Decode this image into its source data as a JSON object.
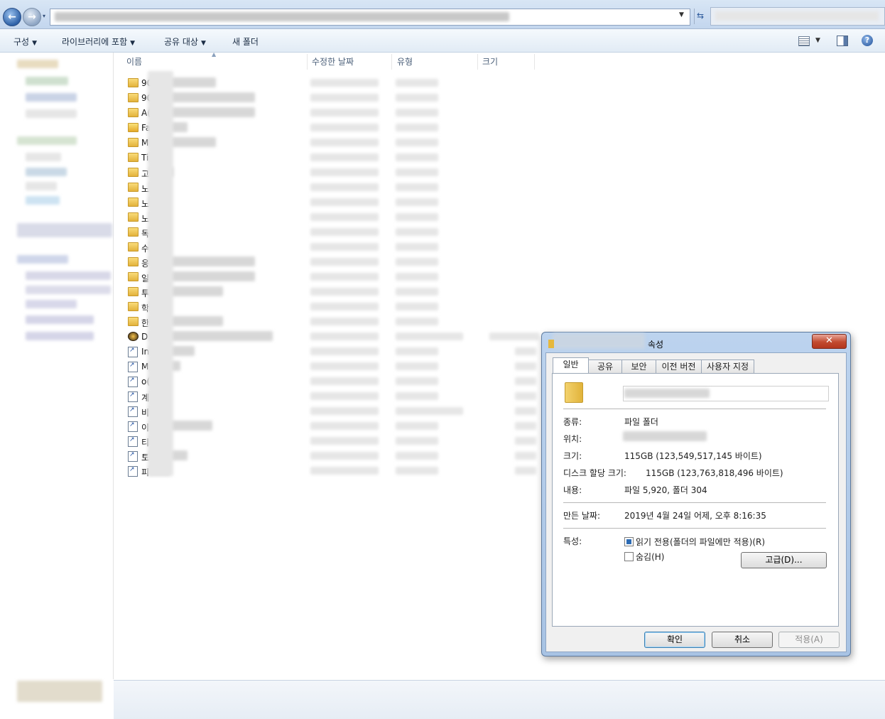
{
  "toolbar": {
    "organize": "구성",
    "include_in_library": "라이브러리에 포함",
    "share_with": "공유 대상",
    "new_folder": "새 폴더"
  },
  "columns": {
    "name": "이름",
    "date_modified": "수정한 날짜",
    "type": "유형",
    "size": "크기"
  },
  "files": [
    {
      "name": "90",
      "icon": "folder-icon"
    },
    {
      "name": "90",
      "icon": "folder-icon"
    },
    {
      "name": "A(",
      "icon": "folder-icon"
    },
    {
      "name": "Fa",
      "icon": "favorites-folder-icon"
    },
    {
      "name": "M",
      "icon": "folder-icon"
    },
    {
      "name": "Ti",
      "icon": "folder-icon"
    },
    {
      "name": "고",
      "icon": "folder-icon"
    },
    {
      "name": "노",
      "icon": "folder-icon"
    },
    {
      "name": "노",
      "icon": "folder-icon"
    },
    {
      "name": "노",
      "icon": "folder-icon"
    },
    {
      "name": "독",
      "icon": "folder-icon"
    },
    {
      "name": "수",
      "icon": "folder-icon"
    },
    {
      "name": "응",
      "icon": "folder-icon"
    },
    {
      "name": "일",
      "icon": "folder-icon"
    },
    {
      "name": "투",
      "icon": "folder-icon"
    },
    {
      "name": "학",
      "icon": "folder-icon"
    },
    {
      "name": "한",
      "icon": "folder-icon"
    },
    {
      "name": "D",
      "icon": "app-icon"
    },
    {
      "name": "In",
      "icon": "internet-shortcut-icon"
    },
    {
      "name": "M",
      "icon": "shortcut-icon"
    },
    {
      "name": "o(",
      "icon": "shortcut-icon"
    },
    {
      "name": "계",
      "icon": "shortcut-icon"
    },
    {
      "name": "비",
      "icon": "shortcut-icon"
    },
    {
      "name": "이",
      "icon": "shortcut-icon"
    },
    {
      "name": "티",
      "icon": "shortcut-icon"
    },
    {
      "name": "토",
      "icon": "shortcut-icon"
    },
    {
      "name": "피",
      "icon": "shortcut-icon"
    }
  ],
  "dialog": {
    "title_suffix": "속성",
    "close": "✕",
    "tabs": [
      "일반",
      "공유",
      "보안",
      "이전 버전",
      "사용자 지정"
    ],
    "type_label": "종류:",
    "type_value": "파일 폴더",
    "location_label": "위치:",
    "size_label": "크기:",
    "size_value": "115GB (123,549,517,145 바이트)",
    "disk_size_label": "디스크 할당 크기:",
    "disk_size_value": "115GB (123,763,818,496 바이트)",
    "contains_label": "내용:",
    "contains_value": "파일 5,920, 폴더 304",
    "created_label": "만든 날짜:",
    "created_value": "2019년 4월 24일 어제, 오후 8:16:35",
    "attributes_label": "특성:",
    "readonly_label": "읽기 전용(폴더의 파일에만 적용)(R)",
    "readonly_checked": true,
    "hidden_label": "숨김(H)",
    "hidden_checked": false,
    "advanced_button": "고급(D)...",
    "ok_button": "확인",
    "cancel_button": "취소",
    "apply_button": "적용(A)"
  }
}
